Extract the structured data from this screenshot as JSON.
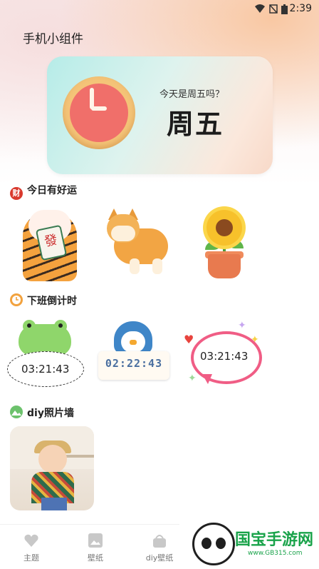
{
  "status_bar": {
    "time": "2:39",
    "icons": [
      "wifi-icon",
      "signal-off-icon",
      "battery-icon"
    ]
  },
  "app": {
    "title": "手机小组件"
  },
  "hero": {
    "question": "今天是周五吗？",
    "answer": "周五"
  },
  "sections": {
    "fortune": {
      "title": "今日有好运",
      "icon_char": "财"
    },
    "countdown": {
      "title": "下班倒计时"
    },
    "photo_wall": {
      "title": "diy照片墙"
    }
  },
  "fortune_items": [
    {
      "name": "lucky-cat-paw",
      "card_text": "發"
    },
    {
      "name": "shiba-dog"
    },
    {
      "name": "sunflower-pot"
    }
  ],
  "countdown_items": [
    {
      "time": "03:21:43"
    },
    {
      "time": "02:22:43"
    },
    {
      "time": "03:21:43"
    }
  ],
  "nav": [
    {
      "label": "主题",
      "icon": "heart-icon"
    },
    {
      "label": "壁纸",
      "icon": "image-icon"
    },
    {
      "label": "diy壁纸",
      "icon": "basket-icon"
    }
  ],
  "watermark": {
    "title": "国宝手游网",
    "url": "www.GB315.com"
  },
  "colors": {
    "accent_pink": "#f05d85",
    "frog_green": "#8fd66b",
    "penguin_blue": "#3f86c8"
  }
}
